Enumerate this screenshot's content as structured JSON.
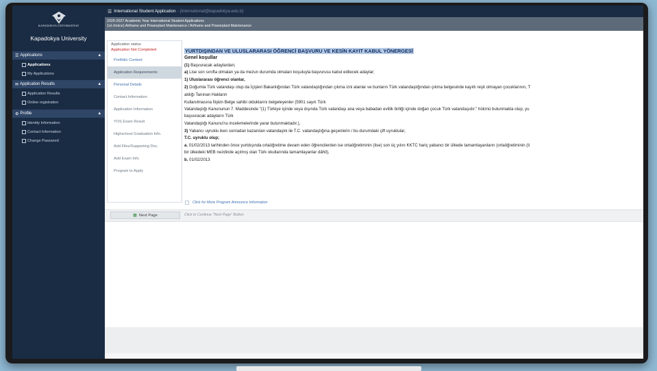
{
  "sidebar": {
    "logo_text": "KAPADOKYA ÜNİVERSİTESİ",
    "university_name": "Kapadokya University",
    "sections": [
      {
        "label": "Applications",
        "items": [
          {
            "label": "Applications",
            "active": true
          },
          {
            "label": "My Applications"
          }
        ]
      },
      {
        "label": "Application Results",
        "items": [
          {
            "label": "Application Results"
          },
          {
            "label": "Online registration"
          }
        ]
      },
      {
        "label": "Profile",
        "items": [
          {
            "label": "Identity Information"
          },
          {
            "label": "Contact Information"
          },
          {
            "label": "Change Password"
          }
        ]
      }
    ]
  },
  "topbar": {
    "title": "International Student Application",
    "email": "- (international@kapadokya.edu.tr)"
  },
  "titlebar": {
    "line1": "2026-2027 Academic Year International Student Applications",
    "line2": "1st choice) Airframe and Powerplant Maintenance / Airframe and Powerplant Maintenance"
  },
  "status": {
    "label": "Application status",
    "value": "Application Not Completed"
  },
  "tabs": [
    "Portfolio Content",
    "Application Requirements",
    "Personal Details",
    "Contact Information",
    "Application Information",
    "YOS Exam Result",
    "Highschool Graduation Info.",
    "Add Files/Supporting Doc.",
    "Add Exam Info",
    "Program to Apply"
  ],
  "content": {
    "title": "YURTDIŞINDAN VE ULUSLARARASI ÖĞRENCİ BAŞVURU VE KESİN KAYIT KABUL YÖNERGESİ",
    "heading": "Genel koşullar",
    "l1_num": "(1)",
    "l1": " Başvuracak adaylardan;",
    "l2_num": "a)",
    "l2": " Lise son sınıfta olmaları ya da mezun durumda olmaları koşuluyla başvurusu kabul edilecek adaylar;",
    "l3": "1) Uluslararası öğrenci olanlar,",
    "l4_num": "2)",
    "l4": " Doğumla Türk vatandaşı olup da İçişleri Bakanlığından Türk vatandaşlığından çıkma izni alanlar ve bunların Türk vatandaşlığından çıkma belgesinde kayıtlı reşit olmayan çocuklarının, T",
    "l5": "aldığı Tanınan Hakların",
    "l6": "Kullanılmasına İlişkin Belge sahibi olduklarını belgeleyenler (5901 sayılı Türk",
    "l7": "Vatandaşlığı Kanununun 7. Maddesinde \"(1) Türkiye içinde veya dışında Türk vatandaşı ana veya babadan evlilik birliği içinde doğan çocuk Türk vatandaşıdır.\" hükmü bulunmakta olup, yu",
    "l8": "başvuracak adayların Türk",
    "l9": "Vatandaşlığı Kanunu'nu incelemelerinde yarar bulunmaktadır.),",
    "l10_num": "3)",
    "l10": " Yabancı uyruklu iken sonradan kazanılan vatandaşlık ile T.C. vatandaşlığına geçenlerin / bu durumdaki çift uyruklular,",
    "l11": "T.C. uyruklu olup;",
    "l12_num": "a.",
    "l12": " 01/02/2013 tarihinden önce yurtdışında ortaöğretime devam eden öğrencilerden ise ortaöğretiminin (lise) son üç yılını KKTC hariç yabancı bir ülkede tamamlayanların (ortaöğretiminin (li",
    "l13": "bir ülkedeki MEB nezdinde açılmış olan Türk okullarında tamamlayanlar dâhil),",
    "l14_num": "b.",
    "l14": " 01/02/2013"
  },
  "more_info": "Click for More Program Announce Information",
  "next_button": "Next Page",
  "next_hint": "Click to Continue \"Next Page\" Button"
}
